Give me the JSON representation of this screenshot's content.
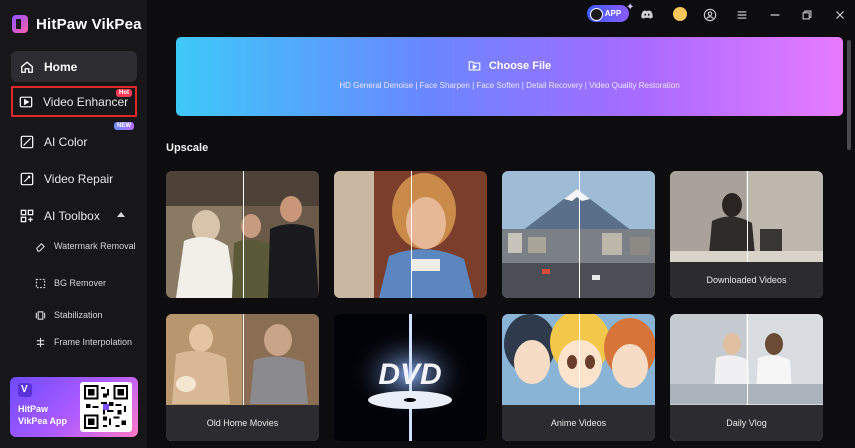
{
  "app": {
    "name": "HitPaw VikPea"
  },
  "sidebar": {
    "items": [
      {
        "label": "Home"
      },
      {
        "label": "Video Enhancer",
        "badge": "Hot"
      },
      {
        "label": "AI Color",
        "badge": "NEW"
      },
      {
        "label": "Video Repair"
      },
      {
        "label": "AI Toolbox"
      }
    ],
    "toolbox_items": [
      {
        "label": "Watermark Removal"
      },
      {
        "label": "BG Remover"
      },
      {
        "label": "Stabilization"
      },
      {
        "label": "Frame Interpolation"
      }
    ],
    "promo": {
      "text": "HitPaw VikPea App"
    }
  },
  "topbar": {
    "app_badge": "APP"
  },
  "banner": {
    "title": "Choose File",
    "subtitle": "HD General Denoise | Face Sharpen | Face Soften | Detail Recovery | Video Quality Restoration"
  },
  "upscale": {
    "title": "Upscale",
    "cards": [
      {
        "label": ""
      },
      {
        "label": ""
      },
      {
        "label": ""
      },
      {
        "label": "Downloaded Videos"
      },
      {
        "label": "Old Home Movies"
      },
      {
        "label": ""
      },
      {
        "label": "Anime Videos"
      },
      {
        "label": "Daily Vlog"
      }
    ],
    "dvd_logo_text": "DVD"
  },
  "colors": {
    "accent_red": "#e0282b",
    "hot_badge": "#ff3b54",
    "banner_start": "#3ec9f8",
    "banner_end": "#e77bff"
  }
}
